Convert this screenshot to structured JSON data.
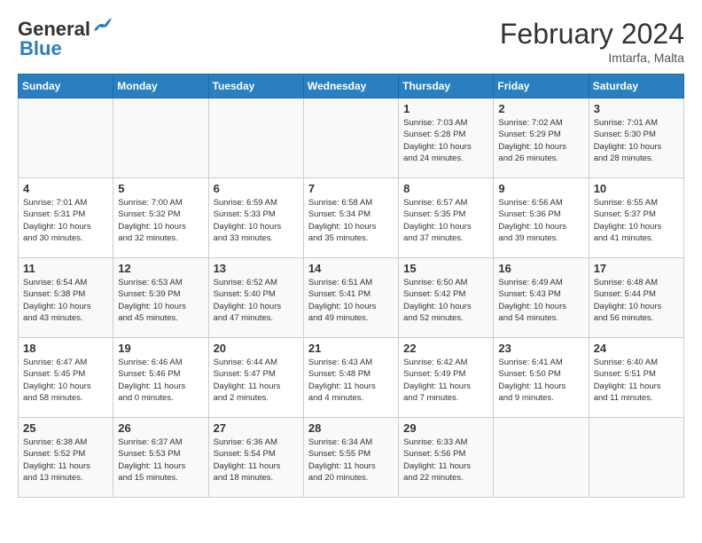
{
  "header": {
    "logo_line1": "General",
    "logo_line2": "Blue",
    "month_title": "February 2024",
    "subtitle": "Imtarfa, Malta"
  },
  "weekdays": [
    "Sunday",
    "Monday",
    "Tuesday",
    "Wednesday",
    "Thursday",
    "Friday",
    "Saturday"
  ],
  "weeks": [
    [
      {
        "day": "",
        "info": ""
      },
      {
        "day": "",
        "info": ""
      },
      {
        "day": "",
        "info": ""
      },
      {
        "day": "",
        "info": ""
      },
      {
        "day": "1",
        "info": "Sunrise: 7:03 AM\nSunset: 5:28 PM\nDaylight: 10 hours\nand 24 minutes."
      },
      {
        "day": "2",
        "info": "Sunrise: 7:02 AM\nSunset: 5:29 PM\nDaylight: 10 hours\nand 26 minutes."
      },
      {
        "day": "3",
        "info": "Sunrise: 7:01 AM\nSunset: 5:30 PM\nDaylight: 10 hours\nand 28 minutes."
      }
    ],
    [
      {
        "day": "4",
        "info": "Sunrise: 7:01 AM\nSunset: 5:31 PM\nDaylight: 10 hours\nand 30 minutes."
      },
      {
        "day": "5",
        "info": "Sunrise: 7:00 AM\nSunset: 5:32 PM\nDaylight: 10 hours\nand 32 minutes."
      },
      {
        "day": "6",
        "info": "Sunrise: 6:59 AM\nSunset: 5:33 PM\nDaylight: 10 hours\nand 33 minutes."
      },
      {
        "day": "7",
        "info": "Sunrise: 6:58 AM\nSunset: 5:34 PM\nDaylight: 10 hours\nand 35 minutes."
      },
      {
        "day": "8",
        "info": "Sunrise: 6:57 AM\nSunset: 5:35 PM\nDaylight: 10 hours\nand 37 minutes."
      },
      {
        "day": "9",
        "info": "Sunrise: 6:56 AM\nSunset: 5:36 PM\nDaylight: 10 hours\nand 39 minutes."
      },
      {
        "day": "10",
        "info": "Sunrise: 6:55 AM\nSunset: 5:37 PM\nDaylight: 10 hours\nand 41 minutes."
      }
    ],
    [
      {
        "day": "11",
        "info": "Sunrise: 6:54 AM\nSunset: 5:38 PM\nDaylight: 10 hours\nand 43 minutes."
      },
      {
        "day": "12",
        "info": "Sunrise: 6:53 AM\nSunset: 5:39 PM\nDaylight: 10 hours\nand 45 minutes."
      },
      {
        "day": "13",
        "info": "Sunrise: 6:52 AM\nSunset: 5:40 PM\nDaylight: 10 hours\nand 47 minutes."
      },
      {
        "day": "14",
        "info": "Sunrise: 6:51 AM\nSunset: 5:41 PM\nDaylight: 10 hours\nand 49 minutes."
      },
      {
        "day": "15",
        "info": "Sunrise: 6:50 AM\nSunset: 5:42 PM\nDaylight: 10 hours\nand 52 minutes."
      },
      {
        "day": "16",
        "info": "Sunrise: 6:49 AM\nSunset: 5:43 PM\nDaylight: 10 hours\nand 54 minutes."
      },
      {
        "day": "17",
        "info": "Sunrise: 6:48 AM\nSunset: 5:44 PM\nDaylight: 10 hours\nand 56 minutes."
      }
    ],
    [
      {
        "day": "18",
        "info": "Sunrise: 6:47 AM\nSunset: 5:45 PM\nDaylight: 10 hours\nand 58 minutes."
      },
      {
        "day": "19",
        "info": "Sunrise: 6:46 AM\nSunset: 5:46 PM\nDaylight: 11 hours\nand 0 minutes."
      },
      {
        "day": "20",
        "info": "Sunrise: 6:44 AM\nSunset: 5:47 PM\nDaylight: 11 hours\nand 2 minutes."
      },
      {
        "day": "21",
        "info": "Sunrise: 6:43 AM\nSunset: 5:48 PM\nDaylight: 11 hours\nand 4 minutes."
      },
      {
        "day": "22",
        "info": "Sunrise: 6:42 AM\nSunset: 5:49 PM\nDaylight: 11 hours\nand 7 minutes."
      },
      {
        "day": "23",
        "info": "Sunrise: 6:41 AM\nSunset: 5:50 PM\nDaylight: 11 hours\nand 9 minutes."
      },
      {
        "day": "24",
        "info": "Sunrise: 6:40 AM\nSunset: 5:51 PM\nDaylight: 11 hours\nand 11 minutes."
      }
    ],
    [
      {
        "day": "25",
        "info": "Sunrise: 6:38 AM\nSunset: 5:52 PM\nDaylight: 11 hours\nand 13 minutes."
      },
      {
        "day": "26",
        "info": "Sunrise: 6:37 AM\nSunset: 5:53 PM\nDaylight: 11 hours\nand 15 minutes."
      },
      {
        "day": "27",
        "info": "Sunrise: 6:36 AM\nSunset: 5:54 PM\nDaylight: 11 hours\nand 18 minutes."
      },
      {
        "day": "28",
        "info": "Sunrise: 6:34 AM\nSunset: 5:55 PM\nDaylight: 11 hours\nand 20 minutes."
      },
      {
        "day": "29",
        "info": "Sunrise: 6:33 AM\nSunset: 5:56 PM\nDaylight: 11 hours\nand 22 minutes."
      },
      {
        "day": "",
        "info": ""
      },
      {
        "day": "",
        "info": ""
      }
    ]
  ]
}
